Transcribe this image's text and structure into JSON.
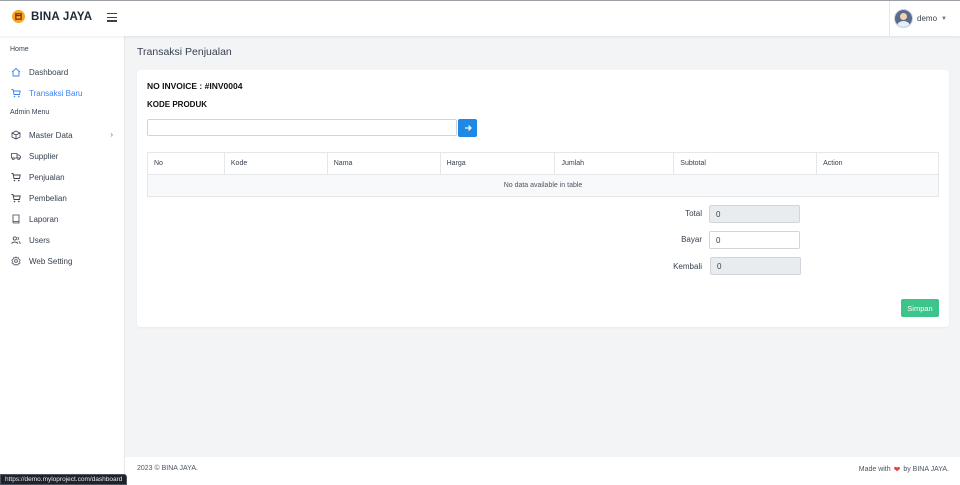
{
  "brand": {
    "name": "BINA JAYA",
    "logo_icon": "store-logo-icon",
    "logo_color": "#f5a623"
  },
  "header": {
    "user_name": "demo"
  },
  "sidebar": {
    "home_heading": "Home",
    "admin_heading": "Admin Menu",
    "items": [
      {
        "label": "Dashboard",
        "icon": "home-icon"
      },
      {
        "label": "Transaksi Baru",
        "icon": "cart-icon",
        "active": true
      },
      {
        "label": "Master Data",
        "icon": "box-icon",
        "has_submenu": true
      },
      {
        "label": "Supplier",
        "icon": "truck-icon"
      },
      {
        "label": "Penjualan",
        "icon": "cart-icon"
      },
      {
        "label": "Pembelian",
        "icon": "cart-icon"
      },
      {
        "label": "Laporan",
        "icon": "book-icon"
      },
      {
        "label": "Users",
        "icon": "users-icon"
      },
      {
        "label": "Web Setting",
        "icon": "gear-icon"
      }
    ]
  },
  "main": {
    "page_title": "Transaksi Penjualan",
    "invoice": "NO INVOICE : #INV0004",
    "kode_label": "KODE PRODUK",
    "kode_value": "",
    "table": {
      "columns": [
        "No",
        "Kode",
        "Nama",
        "Harga",
        "Jumlah",
        "Subtotal",
        "Action"
      ],
      "empty_text": "No data available in table"
    },
    "summary": {
      "total_label": "Total",
      "total_value": "0",
      "bayar_label": "Bayar",
      "bayar_value": "0",
      "kembali_label": "Kembali",
      "kembali_value": "0"
    },
    "save_label": "Simpan"
  },
  "footer": {
    "copyright": "2023 © BINA JAYA.",
    "made_with": "Made with",
    "by": "by BINA JAYA."
  },
  "status_url": "https://demo.myloproject.com/dashboard",
  "colors": {
    "accent": "#3b82f6",
    "primary_button": "#1e88e5",
    "save_button": "#3cc48a",
    "heart": "#e53e3e"
  }
}
